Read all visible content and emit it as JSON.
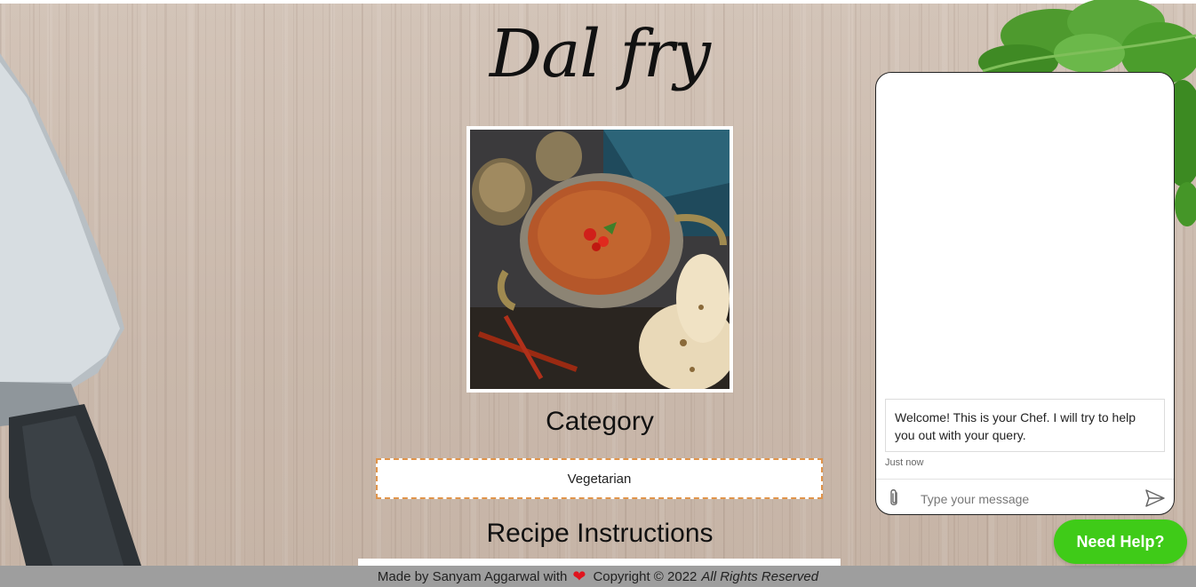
{
  "recipe": {
    "title": "Dal fry",
    "category_heading": "Category",
    "category_value": "Vegetarian",
    "instructions_heading": "Recipe Instructions"
  },
  "footer": {
    "made_by": "Made by Sanyam Aggarwal with",
    "heart_icon": "heart-icon",
    "copyright": "Copyright © 2022",
    "rights": "All Rights Reserved"
  },
  "chat": {
    "welcome_message": "Welcome! This is your Chef. I will try to help you out with your query.",
    "timestamp": "Just now",
    "input_placeholder": "Type your message",
    "attach_icon": "paperclip-icon",
    "send_icon": "send-icon"
  },
  "help_button": {
    "label": "Need Help?"
  },
  "colors": {
    "help_button": "#3fcb18",
    "category_border": "#e0944a",
    "footer_bg": "#9e9e9e",
    "heart": "#e0141e"
  }
}
